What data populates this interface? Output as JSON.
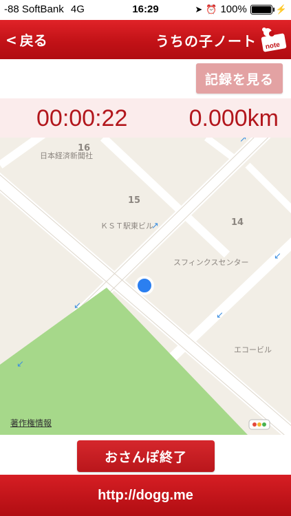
{
  "status_bar": {
    "carrier": "-88 SoftBank",
    "network": "4G",
    "time": "16:29",
    "battery": "100%"
  },
  "header": {
    "back_label": "戻る",
    "title": "うちの子ノート",
    "logo_text": "note"
  },
  "actions": {
    "records_label": "記録を見る"
  },
  "stats": {
    "elapsed": "00:00:22",
    "distance": "0.000km"
  },
  "map": {
    "labels": {
      "block_16": "16",
      "block_15": "15",
      "block_14": "14",
      "nikkei": "日本経済新聞社",
      "kst": "ＫＳＴ駅東ビル",
      "sphinx": "スフィンクスセンター",
      "eco": "エコービル"
    },
    "credit": "著作権情報"
  },
  "bottom": {
    "end_walk_label": "おさんぽ終了",
    "footer_url": "http://dogg.me"
  },
  "colors": {
    "brand_red": "#c21217",
    "stats_text": "#b2161c",
    "park_green": "#a6d88a",
    "location_blue": "#2b7ff0"
  }
}
